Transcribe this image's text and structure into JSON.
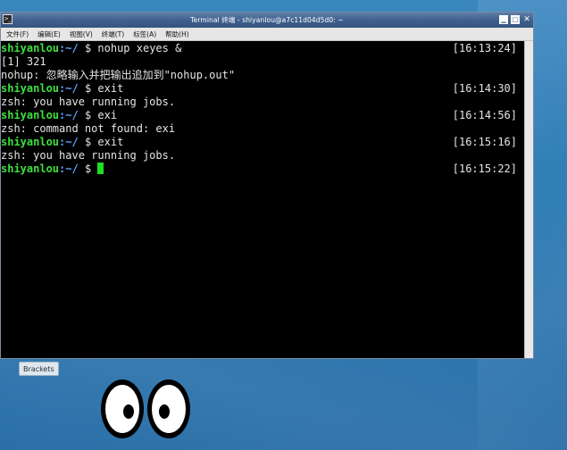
{
  "window": {
    "title": "Terminal 终端 - shiyanlou@a7c11d04d5d0: ~",
    "app_icon": "terminal-icon",
    "controls": [
      "minimize-icon",
      "maximize-icon",
      "close-icon"
    ]
  },
  "menubar": {
    "items": [
      {
        "label": "文件(F)"
      },
      {
        "label": "编辑(E)"
      },
      {
        "label": "视图(V)"
      },
      {
        "label": "终端(T)"
      },
      {
        "label": "标签(A)"
      },
      {
        "label": "帮助(H)"
      }
    ]
  },
  "terminal": {
    "lines": [
      {
        "type": "prompt",
        "user": "shiyanlou",
        "path": ":~/",
        "symbol": " $ ",
        "command": "nohup xeyes &",
        "time": "[16:13:24]"
      },
      {
        "type": "output",
        "text": "[1] 321"
      },
      {
        "type": "output",
        "text": "nohup: 忽略输入并把输出追加到\"nohup.out\""
      },
      {
        "type": "prompt",
        "user": "shiyanlou",
        "path": ":~/",
        "symbol": " $ ",
        "command": "exit",
        "time": "[16:14:30]"
      },
      {
        "type": "output",
        "text": "zsh: you have running jobs."
      },
      {
        "type": "prompt",
        "user": "shiyanlou",
        "path": ":~/",
        "symbol": " $ ",
        "command": "exi",
        "time": "[16:14:56]"
      },
      {
        "type": "output",
        "text": "zsh: command not found: exi"
      },
      {
        "type": "prompt",
        "user": "shiyanlou",
        "path": ":~/",
        "symbol": " $ ",
        "command": "exit",
        "time": "[16:15:16]"
      },
      {
        "type": "output",
        "text": "zsh: you have running jobs."
      },
      {
        "type": "prompt",
        "user": "shiyanlou",
        "path": ":~/",
        "symbol": " $ ",
        "command": "",
        "time": "[16:15:22]",
        "cursor": true
      }
    ],
    "colors": {
      "background": "#000000",
      "user": "#3fe03f",
      "path": "#5aa0ff",
      "text": "#e5e5e5",
      "cursor": "#22dd22"
    }
  },
  "desktop": {
    "task_label": "Brackets",
    "xeyes_icon": "eyes-icon"
  }
}
